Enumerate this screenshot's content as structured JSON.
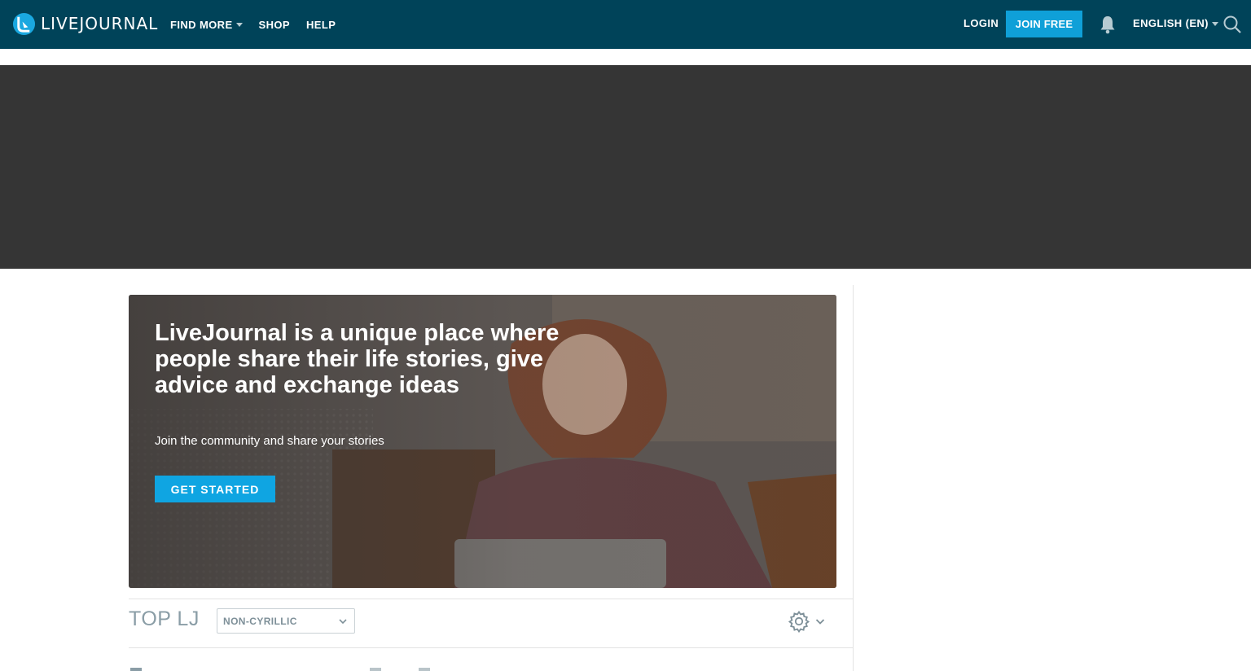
{
  "header": {
    "logo_text": "LIVEJOURNAL",
    "nav": [
      {
        "label": "FIND MORE",
        "has_dropdown": true
      },
      {
        "label": "SHOP",
        "has_dropdown": false
      },
      {
        "label": "HELP",
        "has_dropdown": false
      }
    ],
    "login_label": "LOGIN",
    "join_label": "JOIN FREE",
    "language_label": "ENGLISH (EN)",
    "icons": [
      "livejournal-logo-icon",
      "bell-icon",
      "search-icon"
    ]
  },
  "hero": {
    "title": "LiveJournal is a unique place where people share their life stories, give advice and exchange ideas",
    "subtitle": "Join the community and share your stories",
    "cta_label": "GET STARTED"
  },
  "top": {
    "title": "TOP LJ",
    "filter_value": "NON-CYRILLIC",
    "icons": [
      "gear-icon",
      "chevron-down-icon"
    ]
  },
  "colors": {
    "header_bg": "#004359",
    "accent": "#0fa0d8",
    "ad_bg": "#353535",
    "muted_text": "#8a9da6"
  }
}
